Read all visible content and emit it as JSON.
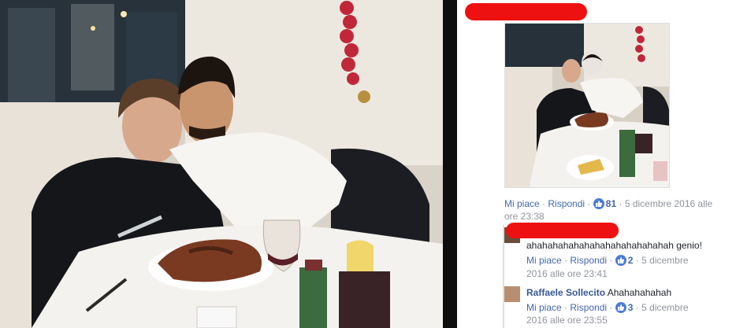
{
  "post": {
    "like_label": "Mi piace",
    "reply_label": "Rispondi",
    "like_count": "81",
    "date_line1": "5 dicembre 2016 alle",
    "date_line2": "ore 23:38"
  },
  "replies": [
    {
      "author": "",
      "text": "ahahahahahahahahahahahahahah genio!",
      "like_label": "Mi piace",
      "reply_label": "Rispondi",
      "like_count": "2",
      "date_line1": "5 dicembre",
      "date_line2": "2016 alle ore 23:41"
    },
    {
      "author": "Raffaele Sollecito",
      "text": "Ahahahahahah",
      "like_label": "Mi piace",
      "reply_label": "Rispondi",
      "like_count": "3",
      "date_line1": "5 dicembre",
      "date_line2": "2016 alle ore 23:55"
    }
  ],
  "colors": {
    "link": "#4267b2",
    "redaction": "#ee1111",
    "divider": "#0e0e0e"
  },
  "icons": [
    "thumbs-up-icon"
  ]
}
